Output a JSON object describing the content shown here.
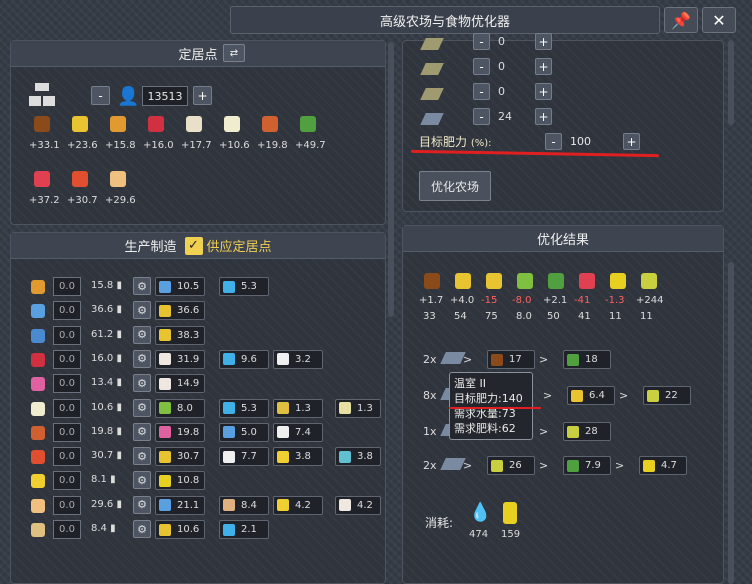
{
  "window": {
    "title": "高级农场与食物优化器",
    "pin_icon": "pin-icon",
    "close_icon": "close-icon"
  },
  "settlement": {
    "title": "定居点",
    "population": "13513",
    "minus": "-",
    "plus": "+",
    "foods": [
      {
        "icon": "cocoa",
        "value": "+33.1",
        "color": "#8a4a1a"
      },
      {
        "icon": "corn",
        "value": "+23.6",
        "color": "#e8c430"
      },
      {
        "icon": "bread",
        "value": "+15.8",
        "color": "#e09a30"
      },
      {
        "icon": "meat",
        "value": "+16.0",
        "color": "#d03040"
      },
      {
        "icon": "dumpling",
        "value": "+17.7",
        "color": "#e8e0c8"
      },
      {
        "icon": "tofu",
        "value": "+10.6",
        "color": "#f0ecd0"
      },
      {
        "icon": "sausage",
        "value": "+19.8",
        "color": "#d06030"
      },
      {
        "icon": "salad",
        "value": "+49.7",
        "color": "#50a040"
      },
      {
        "icon": "fruit",
        "value": "+37.2",
        "color": "#e04050"
      },
      {
        "icon": "jam",
        "value": "+30.7",
        "color": "#e05030"
      },
      {
        "icon": "cake",
        "value": "+29.6",
        "color": "#f0c080"
      }
    ]
  },
  "production": {
    "title": "生产制造",
    "supply_label": "供应定居点",
    "checked": "✓",
    "rows": [
      {
        "val": "0.0",
        "rate": "15.8",
        "color": "#e09a30",
        "inputs": [
          {
            "v": "10.5",
            "c": "#5aa0e0"
          },
          {
            "v": "5.3",
            "c": "#40b0e8"
          }
        ]
      },
      {
        "val": "0.0",
        "rate": "36.6",
        "color": "#5aa0e0",
        "inputs": [
          {
            "v": "36.6",
            "c": "#e8c430"
          }
        ]
      },
      {
        "val": "0.0",
        "rate": "61.2",
        "color": "#4a8ad0",
        "inputs": [
          {
            "v": "38.3",
            "c": "#e8c430"
          }
        ]
      },
      {
        "val": "0.0",
        "rate": "16.0",
        "color": "#d03040",
        "inputs": [
          {
            "v": "31.9",
            "c": "#f0e8e0"
          },
          {
            "v": "9.6",
            "c": "#40b0e8"
          },
          {
            "v": "3.2",
            "c": "#f0f0f0"
          }
        ]
      },
      {
        "val": "0.0",
        "rate": "13.4",
        "color": "#e060a0",
        "inputs": [
          {
            "v": "14.9",
            "c": "#f0e8e0"
          }
        ]
      },
      {
        "val": "0.0",
        "rate": "10.6",
        "color": "#f0ecd0",
        "inputs": [
          {
            "v": "8.0",
            "c": "#80c040"
          },
          {
            "v": "5.3",
            "c": "#40b0e8"
          },
          {
            "v": "1.3",
            "c": "#e0c040"
          },
          {
            "v": "1.3",
            "c": "#e8e0a0"
          }
        ]
      },
      {
        "val": "0.0",
        "rate": "19.8",
        "color": "#d06030",
        "inputs": [
          {
            "v": "19.8",
            "c": "#e060a0"
          },
          {
            "v": "5.0",
            "c": "#5aa0e0"
          },
          {
            "v": "7.4",
            "c": "#f0f0f0"
          }
        ]
      },
      {
        "val": "0.0",
        "rate": "30.7",
        "color": "#e05030",
        "inputs": [
          {
            "v": "30.7",
            "c": "#e8c430"
          },
          {
            "v": "7.7",
            "c": "#f0f0f0"
          },
          {
            "v": "3.8",
            "c": "#f0d030"
          },
          {
            "v": "3.8",
            "c": "#60c0d0"
          }
        ]
      },
      {
        "val": "0.0",
        "rate": "8.1",
        "color": "#f0d030",
        "inputs": [
          {
            "v": "10.8",
            "c": "#e8d020"
          }
        ]
      },
      {
        "val": "0.0",
        "rate": "29.6",
        "color": "#f0c080",
        "inputs": [
          {
            "v": "21.1",
            "c": "#5aa0e0"
          },
          {
            "v": "8.4",
            "c": "#e0b080"
          },
          {
            "v": "4.2",
            "c": "#f0d030"
          },
          {
            "v": "4.2",
            "c": "#f0e8e0"
          }
        ]
      },
      {
        "val": "0.0",
        "rate": "8.4",
        "color": "#e0c080",
        "inputs": [
          {
            "v": "10.6",
            "c": "#e8c430"
          },
          {
            "v": "2.1",
            "c": "#40b0e8"
          }
        ]
      }
    ]
  },
  "farm": {
    "fields": [
      {
        "val": "0"
      },
      {
        "val": "0"
      },
      {
        "val": "0"
      },
      {
        "val": "24"
      }
    ],
    "fertility_label": "目标肥力",
    "fertility_unit": "(%):",
    "fertility": "100",
    "optimize_button": "优化农场"
  },
  "results": {
    "title": "优化结果",
    "crops": [
      {
        "rate": "+1.7",
        "count": "33",
        "color": "#8a4a1a",
        "neg": false
      },
      {
        "rate": "+4.0",
        "count": "54",
        "color": "#e8c430",
        "neg": false
      },
      {
        "rate": "-15",
        "count": "75",
        "color": "#e8c430",
        "neg": true
      },
      {
        "rate": "-8.0",
        "count": "8.0",
        "color": "#80c040",
        "neg": true
      },
      {
        "rate": "+2.1",
        "count": "50",
        "color": "#50a040",
        "neg": false
      },
      {
        "rate": "-41",
        "count": "41",
        "color": "#e04050",
        "neg": true
      },
      {
        "rate": "-1.3",
        "count": "11",
        "color": "#e8d020",
        "neg": true
      },
      {
        "rate": "+244",
        "count": "11",
        "color": "#c8d040",
        "neg": false
      }
    ],
    "chains": [
      {
        "mult": "2x",
        "steps": [
          {
            "v": "17",
            "c": "#8a4a1a"
          },
          {
            "v": "18",
            "c": "#50a040"
          }
        ]
      },
      {
        "mult": "8x",
        "steps": [
          {
            "v": "6.4",
            "c": "#e8c430"
          },
          {
            "v": "22",
            "c": "#c8d040"
          }
        ]
      },
      {
        "mult": "1x",
        "steps": [
          {
            "v": "28",
            "c": "#c8d040"
          }
        ]
      },
      {
        "mult": "2x",
        "steps": [
          {
            "v": "26",
            "c": "#c8d040"
          },
          {
            "v": "7.9",
            "c": "#50a040"
          },
          {
            "v": "4.7",
            "c": "#e8d020"
          }
        ]
      }
    ],
    "tooltip": {
      "name": "温室 II",
      "fertility": "目标肥力:140",
      "water": "需求水量:73",
      "fertilizer": "需求肥料:62"
    },
    "arrow": ">",
    "consume_label": "消耗:",
    "water": "474",
    "fertilizer": "159"
  }
}
